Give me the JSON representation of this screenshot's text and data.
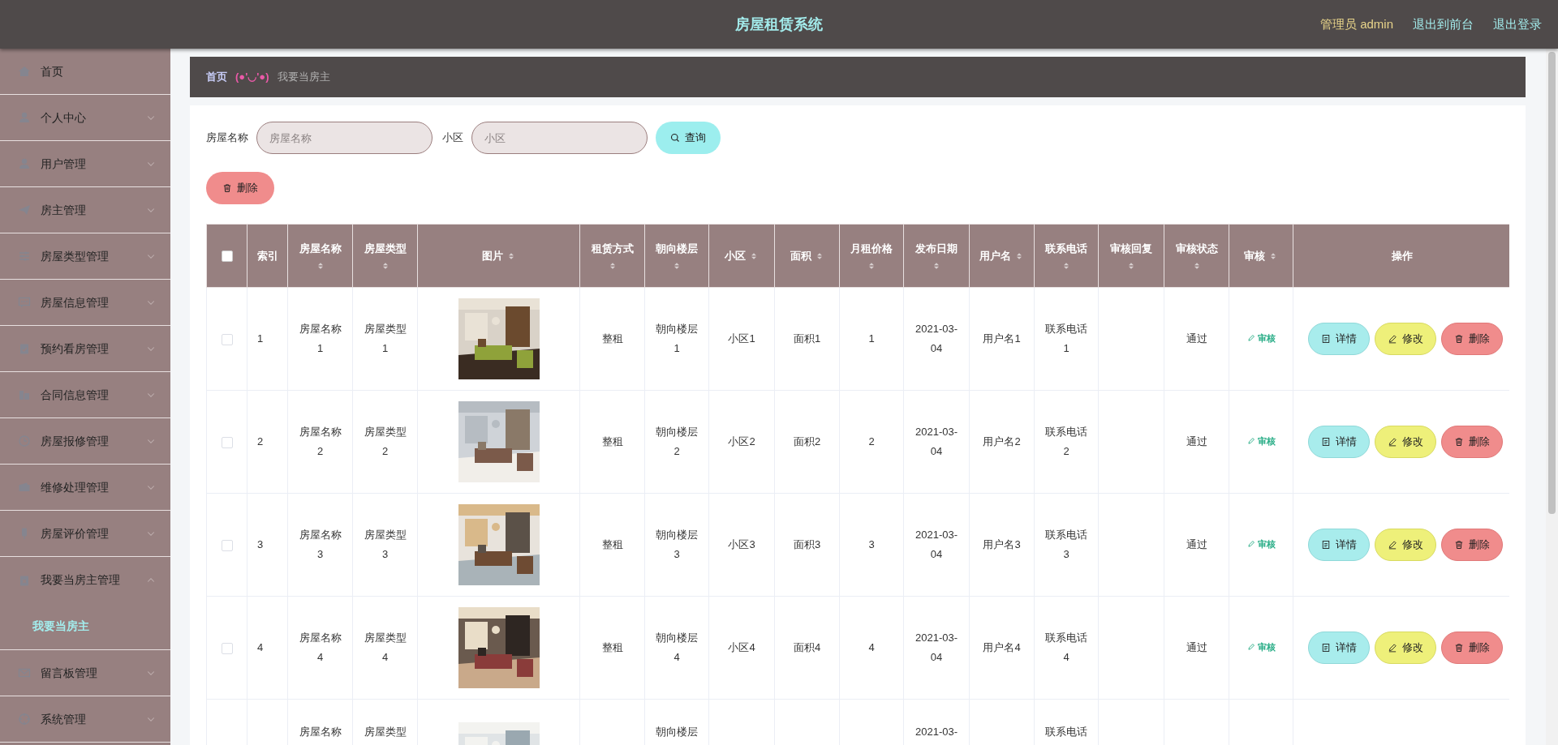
{
  "header": {
    "title": "房屋租赁系统",
    "user": "管理员 admin",
    "links": [
      "退出到前台",
      "退出登录"
    ]
  },
  "sidebar": {
    "items": [
      {
        "label": "首页"
      },
      {
        "label": "个人中心",
        "expanded": false
      },
      {
        "label": "用户管理",
        "expanded": false
      },
      {
        "label": "房主管理",
        "expanded": false
      },
      {
        "label": "房屋类型管理",
        "expanded": false
      },
      {
        "label": "房屋信息管理",
        "expanded": false
      },
      {
        "label": "预约看房管理",
        "expanded": false
      },
      {
        "label": "合同信息管理",
        "expanded": false
      },
      {
        "label": "房屋报修管理",
        "expanded": false
      },
      {
        "label": "维修处理管理",
        "expanded": false
      },
      {
        "label": "房屋评价管理",
        "expanded": false
      },
      {
        "label": "我要当房主管理",
        "expanded": true,
        "children": [
          {
            "label": "我要当房主",
            "selected": true
          }
        ]
      },
      {
        "label": "留言板管理",
        "expanded": false
      },
      {
        "label": "系统管理",
        "expanded": false
      }
    ]
  },
  "breadcrumb": {
    "home": "首页",
    "separator": "(●'◡'●)",
    "current": "我要当房主"
  },
  "search": {
    "fields": [
      {
        "label": "房屋名称",
        "placeholder": "房屋名称"
      },
      {
        "label": "小区",
        "placeholder": "小区"
      }
    ],
    "button": "查询"
  },
  "delete_button": "删除",
  "table": {
    "select_all_checked": false,
    "columns": [
      {
        "label": "索引",
        "sortable": false
      },
      {
        "label": "房屋名称",
        "sortable": true
      },
      {
        "label": "房屋类型",
        "sortable": true
      },
      {
        "label": "图片",
        "sortable": true
      },
      {
        "label": "租赁方式",
        "sortable": true
      },
      {
        "label": "朝向楼层",
        "sortable": true
      },
      {
        "label": "小区",
        "sortable": true
      },
      {
        "label": "面积",
        "sortable": true
      },
      {
        "label": "月租价格",
        "sortable": true
      },
      {
        "label": "发布日期",
        "sortable": true
      },
      {
        "label": "用户名",
        "sortable": true
      },
      {
        "label": "联系电话",
        "sortable": true
      },
      {
        "label": "审核回复",
        "sortable": true
      },
      {
        "label": "审核状态",
        "sortable": true
      },
      {
        "label": "审核",
        "sortable": true
      },
      {
        "label": "操作",
        "sortable": false
      }
    ],
    "rows": [
      {
        "checked": false,
        "cells": [
          "1",
          "房屋名称1",
          "房屋类型1",
          null,
          "整租",
          "朝向楼层1",
          "小区1",
          "面积1",
          "1",
          "2021-03-04",
          "用户名1",
          "联系电话1",
          null,
          "通过"
        ],
        "review_action": "审核",
        "actions": [
          "详情",
          "修改",
          "删除"
        ]
      },
      {
        "checked": false,
        "cells": [
          "2",
          "房屋名称2",
          "房屋类型2",
          null,
          "整租",
          "朝向楼层2",
          "小区2",
          "面积2",
          "2",
          "2021-03-04",
          "用户名2",
          "联系电话2",
          null,
          "通过"
        ],
        "review_action": "审核",
        "actions": [
          "详情",
          "修改",
          "删除"
        ]
      },
      {
        "checked": false,
        "cells": [
          "3",
          "房屋名称3",
          "房屋类型3",
          null,
          "整租",
          "朝向楼层3",
          "小区3",
          "面积3",
          "3",
          "2021-03-04",
          "用户名3",
          "联系电话3",
          null,
          "通过"
        ],
        "review_action": "审核",
        "actions": [
          "详情",
          "修改",
          "删除"
        ]
      },
      {
        "checked": false,
        "cells": [
          "4",
          "房屋名称4",
          "房屋类型4",
          null,
          "整租",
          "朝向楼层4",
          "小区4",
          "面积4",
          "4",
          "2021-03-04",
          "用户名4",
          "联系电话4",
          null,
          "通过"
        ],
        "review_action": "审核",
        "actions": [
          "详情",
          "修改",
          "删除"
        ]
      },
      {
        "partial": true,
        "cells": [
          null,
          "房屋名称",
          "房屋类型",
          null,
          null,
          "朝向楼层",
          null,
          null,
          null,
          "2021-03-",
          null,
          "联系电话",
          null,
          null
        ]
      }
    ]
  }
}
